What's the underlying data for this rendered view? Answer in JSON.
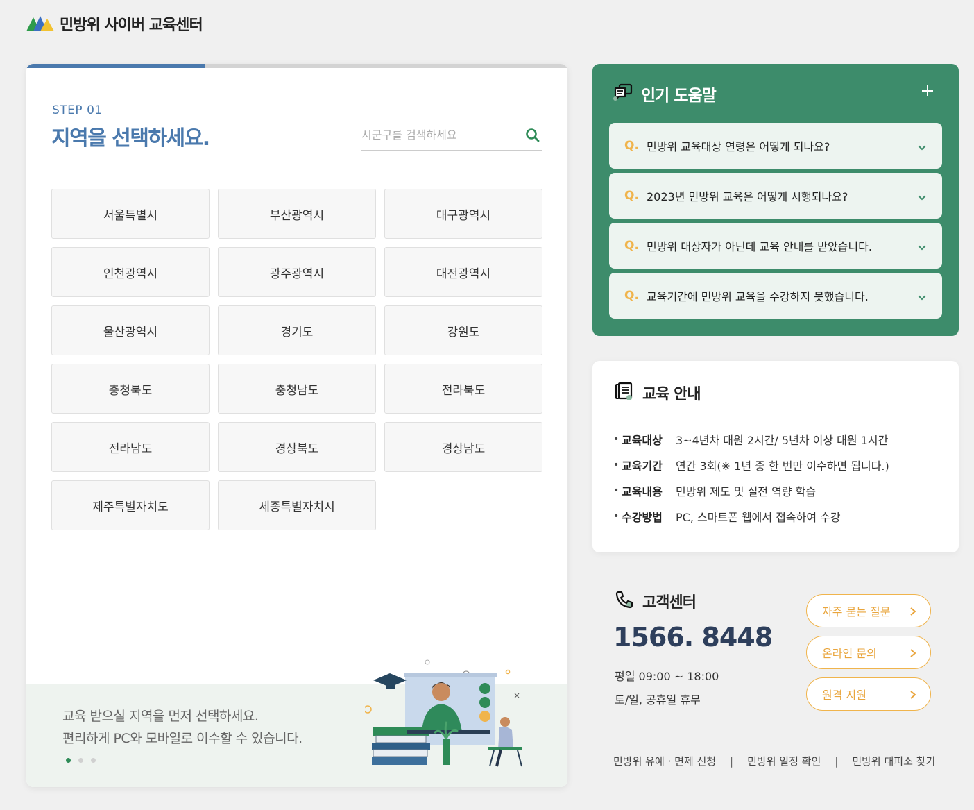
{
  "header": {
    "logo_text": "민방위 사이버 교육센터"
  },
  "region_select": {
    "step_label": "STEP 01",
    "title": "지역을 선택하세요.",
    "search_placeholder": "시군구를 검색하세요",
    "progress_fraction": 0.33,
    "regions": [
      "서울특별시",
      "부산광역시",
      "대구광역시",
      "인천광역시",
      "광주광역시",
      "대전광역시",
      "울산광역시",
      "경기도",
      "강원도",
      "충청북도",
      "충청남도",
      "전라북도",
      "전라남도",
      "경상북도",
      "경상남도",
      "제주특별자치도",
      "세종특별자치시"
    ]
  },
  "banner": {
    "line1": "교육 받으실 지역을 먼저 선택하세요.",
    "line2": "편리하게 PC와 모바일로 이수할 수 있습니다.",
    "slide_count": 3,
    "active_slide": 1
  },
  "help": {
    "title": "인기 도움말",
    "q_marker": "Q.",
    "items": [
      "민방위 교육대상 연령은 어떻게 되나요?",
      "2023년 민방위 교육은 어떻게 시행되나요?",
      "민방위 대상자가 아닌데 교육 안내를 받았습니다.",
      "교육기간에 민방위 교육을 수강하지 못했습니다."
    ]
  },
  "info": {
    "title": "교육 안내",
    "bullet": "•",
    "rows": [
      {
        "key": "교육대상",
        "value": "3~4년차 대원 2시간/ 5년차 이상 대원 1시간"
      },
      {
        "key": "교육기간",
        "value": "연간 3회(※ 1년 중 한 번만 이수하면 됩니다.)"
      },
      {
        "key": "교육내용",
        "value": "민방위 제도 및 실전 역량 학습"
      },
      {
        "key": "수강방법",
        "value": "PC, 스마트폰 웹에서 접속하여 수강"
      }
    ]
  },
  "customer_center": {
    "title": "고객센터",
    "phone": "1566. 8448",
    "weekday_hours": "평일 09:00 ~ 18:00",
    "weekend_hours": "토/일, 공휴일 휴무",
    "buttons": [
      "자주 묻는 질문",
      "온라인 문의",
      "원격 지원"
    ]
  },
  "footer": {
    "links": [
      "민방위 유예 · 면제 신청",
      "민방위 일정 확인",
      "민방위 대피소 찾기"
    ],
    "separator": "|"
  },
  "colors": {
    "primary_blue": "#4a79ad",
    "green": "#3d8c6b",
    "accent_orange": "#f0b44c",
    "phone_navy": "#2e3f5c"
  },
  "icons": [
    "logo-mark",
    "search-icon",
    "chat-bubbles-icon",
    "plus-icon",
    "chevron-down-icon",
    "document-icon",
    "phone-icon",
    "chevron-right-icon"
  ]
}
